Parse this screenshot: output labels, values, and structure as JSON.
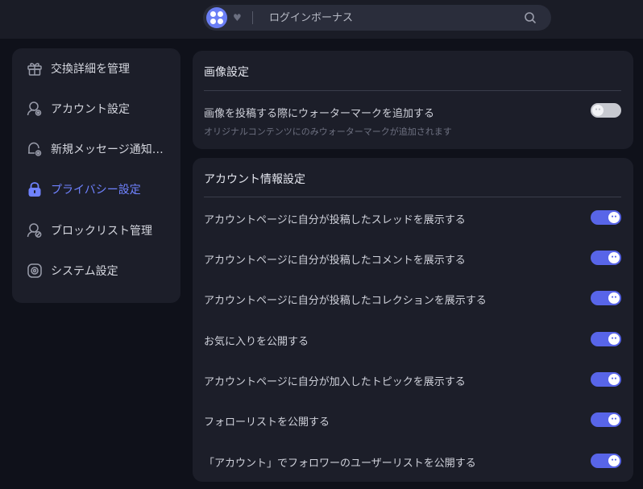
{
  "search": {
    "placeholder": "ログインボーナス"
  },
  "sidebar": {
    "items": [
      {
        "label": "交換詳細を管理",
        "icon": "gift-icon",
        "active": false
      },
      {
        "label": "アカウント設定",
        "icon": "user-gear-icon",
        "active": false
      },
      {
        "label": "新規メッセージ通知設定",
        "icon": "bell-gear-icon",
        "active": false
      },
      {
        "label": "プライバシー設定",
        "icon": "lock-icon",
        "active": true
      },
      {
        "label": "ブロックリスト管理",
        "icon": "user-block-icon",
        "active": false
      },
      {
        "label": "システム設定",
        "icon": "system-gear-icon",
        "active": false
      }
    ]
  },
  "image_settings": {
    "title": "画像設定",
    "watermark": {
      "label": "画像を投稿する際にウォーターマークを追加する",
      "sub": "オリジナルコンテンツにのみウォーターマークが追加されます",
      "enabled": false
    }
  },
  "account_info": {
    "title": "アカウント情報設定",
    "rows": [
      {
        "label": "アカウントページに自分が投稿したスレッドを展示する",
        "enabled": true
      },
      {
        "label": "アカウントページに自分が投稿したコメントを展示する",
        "enabled": true
      },
      {
        "label": "アカウントページに自分が投稿したコレクションを展示する",
        "enabled": true
      },
      {
        "label": "お気に入りを公開する",
        "enabled": true
      },
      {
        "label": "アカウントページに自分が加入したトピックを展示する",
        "enabled": true
      },
      {
        "label": "フォローリストを公開する",
        "enabled": true
      },
      {
        "label": "「アカウント」でフォロワーのユーザーリストを公開する",
        "enabled": true
      }
    ]
  },
  "colors": {
    "accent": "#5865e8",
    "active_text": "#6f82ff",
    "panel": "#1c1e29",
    "background": "#0f111a"
  }
}
